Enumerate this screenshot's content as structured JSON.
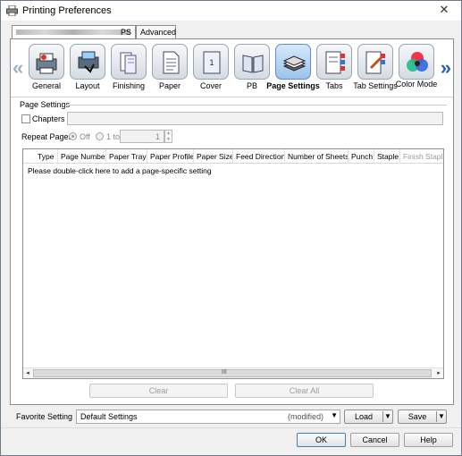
{
  "window": {
    "title": "Printing Preferences",
    "close_glyph": "✕"
  },
  "tabs": [
    {
      "label": "PS",
      "active": true
    },
    {
      "label": "Advanced",
      "active": false
    }
  ],
  "ribbon": {
    "prev_glyph": "«",
    "next_glyph": "»",
    "items": [
      {
        "label": "General",
        "icon": "general-icon",
        "selected": false
      },
      {
        "label": "Layout",
        "icon": "layout-icon",
        "selected": false
      },
      {
        "label": "Finishing",
        "icon": "finishing-icon",
        "selected": false
      },
      {
        "label": "Paper",
        "icon": "paper-icon",
        "selected": false
      },
      {
        "label": "Cover",
        "icon": "cover-icon",
        "selected": false
      },
      {
        "label": "PB",
        "icon": "pb-icon",
        "selected": false
      },
      {
        "label": "Page Settings",
        "icon": "page-settings-icon",
        "selected": true
      },
      {
        "label": "Tabs",
        "icon": "tabs-icon",
        "selected": false
      },
      {
        "label": "Tab Settings",
        "icon": "tab-settings-icon",
        "selected": false
      },
      {
        "label": "Color Mode",
        "icon": "color-mode-icon",
        "selected": false
      }
    ],
    "cover_number": "1"
  },
  "page_settings": {
    "section_title": "Page Settings",
    "chapters_label": "Chapters",
    "chapters_checked": false,
    "chapters_value": "",
    "repeat_pages_label": "Repeat Pages",
    "off_label": "Off",
    "one_to_label": "1 to",
    "repeat_value": "1",
    "repeat_mode": "Off"
  },
  "table": {
    "columns": [
      "Type",
      "Page Number",
      "Paper Tray",
      "Paper Profile",
      "Paper Size",
      "Feed Direction",
      "Number of Sheets",
      "Punch",
      "Staple",
      "Finish Stapling"
    ],
    "visible_last_column": "Finish Staplin",
    "rows": [],
    "hint": "Please double-click here to add a page-specific setting",
    "scroll_grip": "III"
  },
  "actions": {
    "clear": "Clear",
    "clear_all": "Clear All"
  },
  "favorite": {
    "label": "Favorite Setting",
    "value": "Default Settings",
    "modified": "(modified)",
    "load": "Load",
    "save": "Save"
  },
  "dialog_buttons": {
    "ok": "OK",
    "cancel": "Cancel",
    "help": "Help"
  },
  "colors": {
    "selected_ribbon": "#9cc4ea",
    "accent": "#2a63b8"
  }
}
